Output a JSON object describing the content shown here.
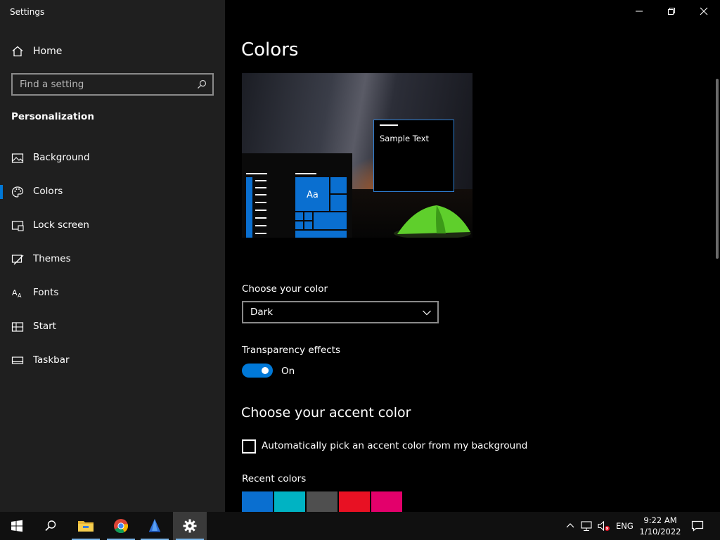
{
  "window": {
    "title": "Settings",
    "controls": {
      "minimize": "minimize-icon",
      "restore": "restore-icon",
      "close": "close-icon"
    }
  },
  "sidebar": {
    "home_label": "Home",
    "search_placeholder": "Find a setting",
    "section_title": "Personalization",
    "items": [
      {
        "label": "Background",
        "icon": "picture-icon"
      },
      {
        "label": "Colors",
        "icon": "palette-icon",
        "selected": true
      },
      {
        "label": "Lock screen",
        "icon": "lock-screen-icon"
      },
      {
        "label": "Themes",
        "icon": "themes-icon"
      },
      {
        "label": "Fonts",
        "icon": "fonts-icon"
      },
      {
        "label": "Start",
        "icon": "start-icon"
      },
      {
        "label": "Taskbar",
        "icon": "taskbar-icon"
      }
    ]
  },
  "main": {
    "title": "Colors",
    "preview": {
      "sample_text": "Sample Text",
      "tile_text": "Aa"
    },
    "choose_color": {
      "label": "Choose your color",
      "value": "Dark"
    },
    "transparency": {
      "label": "Transparency effects",
      "state": "On",
      "enabled": true
    },
    "accent": {
      "heading": "Choose your accent color",
      "auto_pick_label": "Automatically pick an accent color from my background",
      "auto_pick_checked": false,
      "recent_label": "Recent colors",
      "recent_colors": [
        "#0a6fd0",
        "#00b3c3",
        "#4f4f4f",
        "#e81123",
        "#e3006b"
      ]
    }
  },
  "taskbar": {
    "apps": [
      "windows-start-icon",
      "search-icon",
      "file-explorer-icon",
      "chrome-icon",
      "app-icon",
      "settings-gear-icon"
    ],
    "tray": {
      "language": "ENG",
      "time": "9:22 AM",
      "date": "1/10/2022"
    }
  },
  "colors": {
    "accent": "#0078d7",
    "sidebar_bg": "#1f1f1f",
    "main_bg": "#000000"
  }
}
